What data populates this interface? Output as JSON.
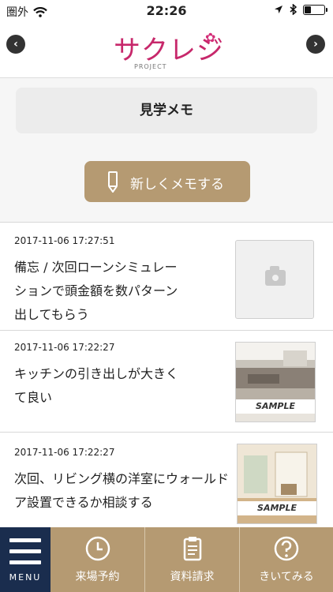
{
  "status_bar": {
    "carrier": "圏外",
    "time": "22:26",
    "battery_level": 0.35
  },
  "header": {
    "logo_text": "サクレジ",
    "logo_subtitle": "PROJECT"
  },
  "page": {
    "title": "見学メモ",
    "new_memo_label": "新しくメモする"
  },
  "memos": [
    {
      "date": "2017-11-06 17:27:51",
      "text_lines": [
        "備忘 / 次回ローンシミュレー",
        "ションで頭金額を数パターン",
        "出してもらう"
      ],
      "thumbnail": "camera-placeholder"
    },
    {
      "date": "2017-11-06 17:22:27",
      "text_lines": [
        "キッチンの引き出しが大きく",
        "て良い"
      ],
      "thumbnail": "kitchen-photo",
      "sample_label": "SAMPLE"
    },
    {
      "date": "2017-11-06 17:22:27",
      "text_lines": [
        "次回、リビング横の洋室にウォールド",
        "ア設置できるか相談する"
      ],
      "thumbnail": "room-photo",
      "sample_label": "SAMPLE"
    }
  ],
  "tab_bar": {
    "menu_label": "MENU",
    "items": [
      {
        "label": "来場予約",
        "icon": "clock-icon"
      },
      {
        "label": "資料請求",
        "icon": "clipboard-icon"
      },
      {
        "label": "きいてみる",
        "icon": "question-icon"
      }
    ]
  },
  "colors": {
    "accent": "#b59a72",
    "menu_bg": "#1a2d4e",
    "logo": "#c7286b"
  }
}
